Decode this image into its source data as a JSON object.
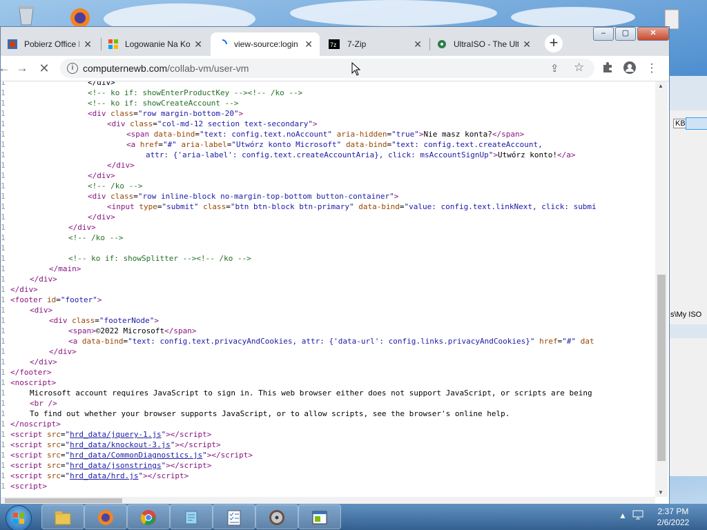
{
  "tabs": [
    {
      "title": "Pobierz Office Pro",
      "favicon": "office-icon"
    },
    {
      "title": "Logowanie Na Ko",
      "favicon": "microsoft-icon"
    },
    {
      "title": "view-source:login",
      "favicon": "loading-icon"
    },
    {
      "title": "7-Zip",
      "favicon": "7zip-icon"
    },
    {
      "title": "UltraISO - The Ult",
      "favicon": "ultraiso-icon"
    }
  ],
  "address": {
    "domain": "computernewb.com",
    "path": "/collab-vm/user-vm"
  },
  "source_lines": [
    {
      "indent": 16,
      "html": "&lt;/div&gt;"
    },
    {
      "indent": 16,
      "html": "&lt;!-- ko if: showEnterProductKey --&gt;&lt;!-- /ko --&gt;",
      "comment": true
    },
    {
      "indent": 16,
      "html": "&lt;!-- ko if: showCreateAccount --&gt;",
      "comment": true
    },
    {
      "indent": 16,
      "html": "<span class=\"tag\">&lt;div</span> <span class=\"att\">class</span>=<span class=\"val\">\"row margin-bottom-20\"</span><span class=\"tag\">&gt;</span>"
    },
    {
      "indent": 20,
      "html": "<span class=\"tag\">&lt;div</span> <span class=\"att\">class</span>=<span class=\"val\">\"col-md-12 section text-secondary\"</span><span class=\"tag\">&gt;</span>"
    },
    {
      "indent": 24,
      "html": "<span class=\"tag\">&lt;span</span> <span class=\"att\">data-bind</span>=<span class=\"val\">\"text: config.text.noAccount\"</span> <span class=\"att\">aria-hidden</span>=<span class=\"val\">\"true\"</span><span class=\"tag\">&gt;</span>Nie masz konta?<span class=\"tag\">&lt;/span&gt;</span>"
    },
    {
      "indent": 24,
      "html": "<span class=\"tag\">&lt;a</span> <span class=\"att\">href</span>=<span class=\"val\">\"#\"</span> <span class=\"att\">aria-label</span>=<span class=\"val\">\"Utwórz konto Microsoft\"</span> <span class=\"att\">data-bind</span>=<span class=\"val\">\"text: config.text.createAccount,</span>"
    },
    {
      "indent": 28,
      "html": "<span class=\"val\">attr: {'aria-label': config.text.createAccountAria}, click: msAccountSignUp\"</span><span class=\"tag\">&gt;</span>Utwórz konto!<span class=\"tag\">&lt;/a&gt;</span>"
    },
    {
      "indent": 20,
      "html": "<span class=\"tag\">&lt;/div&gt;</span>"
    },
    {
      "indent": 16,
      "html": "<span class=\"tag\">&lt;/div&gt;</span>"
    },
    {
      "indent": 16,
      "html": "&lt;!-- /ko --&gt;",
      "comment": true
    },
    {
      "indent": 16,
      "html": "<span class=\"tag\">&lt;div</span> <span class=\"att\">class</span>=<span class=\"val\">\"row inline-block no-margin-top-bottom button-container\"</span><span class=\"tag\">&gt;</span>"
    },
    {
      "indent": 20,
      "html": "<span class=\"tag\">&lt;input</span> <span class=\"att\">type</span>=<span class=\"val\">\"submit\"</span> <span class=\"att\">class</span>=<span class=\"val\">\"btn btn-block btn-primary\"</span> <span class=\"att\">data-bind</span>=<span class=\"val\">\"value: config.text.linkNext, click: submi</span>"
    },
    {
      "indent": 16,
      "html": "<span class=\"tag\">&lt;/div&gt;</span>"
    },
    {
      "indent": 12,
      "html": "<span class=\"tag\">&lt;/div&gt;</span>"
    },
    {
      "indent": 12,
      "html": "&lt;!-- /ko --&gt;",
      "comment": true
    },
    {
      "indent": 0,
      "html": ""
    },
    {
      "indent": 12,
      "html": "&lt;!-- ko if: showSplitter --&gt;&lt;!-- /ko --&gt;",
      "comment": true
    },
    {
      "indent": 8,
      "html": "<span class=\"tag\">&lt;/main&gt;</span>"
    },
    {
      "indent": 4,
      "html": "<span class=\"tag\">&lt;/div&gt;</span>"
    },
    {
      "indent": 0,
      "html": "<span class=\"tag\">&lt;/div&gt;</span>"
    },
    {
      "indent": 0,
      "html": "<span class=\"tag\">&lt;footer</span> <span class=\"att\">id</span>=<span class=\"val\">\"footer\"</span><span class=\"tag\">&gt;</span>"
    },
    {
      "indent": 4,
      "html": "<span class=\"tag\">&lt;div&gt;</span>"
    },
    {
      "indent": 8,
      "html": "<span class=\"tag\">&lt;div</span> <span class=\"att\">class</span>=<span class=\"val\">\"footerNode\"</span><span class=\"tag\">&gt;</span>"
    },
    {
      "indent": 12,
      "html": "<span class=\"tag\">&lt;span&gt;</span>©2022 Microsoft<span class=\"tag\">&lt;/span&gt;</span>"
    },
    {
      "indent": 12,
      "html": "<span class=\"tag\">&lt;a</span> <span class=\"att\">data-bind</span>=<span class=\"val\">\"text: config.text.privacyAndCookies, attr: {'data-url': config.links.privacyAndCookies}\"</span> <span class=\"att\">href</span>=<span class=\"val\">\"#\"</span> <span class=\"att\">dat</span>"
    },
    {
      "indent": 8,
      "html": "<span class=\"tag\">&lt;/div&gt;</span>"
    },
    {
      "indent": 4,
      "html": "<span class=\"tag\">&lt;/div&gt;</span>"
    },
    {
      "indent": 0,
      "html": "<span class=\"tag\">&lt;/footer&gt;</span>"
    },
    {
      "indent": 0,
      "html": "<span class=\"tag\">&lt;noscript&gt;</span>"
    },
    {
      "indent": 4,
      "html": "Microsoft account requires JavaScript to sign in. This web browser either does not support JavaScript, or scripts are being"
    },
    {
      "indent": 4,
      "html": "<span class=\"tag\">&lt;br /&gt;</span>"
    },
    {
      "indent": 4,
      "html": "To find out whether your browser supports JavaScript, or to allow scripts, see the browser's online help."
    },
    {
      "indent": 0,
      "html": "<span class=\"tag\">&lt;/noscript&gt;</span>"
    },
    {
      "indent": 0,
      "html": "<span class=\"tag\">&lt;script</span> <span class=\"att\">src</span>=<span class=\"val\">\"</span><span class=\"lnk\">hrd_data/jquery-1.js</span><span class=\"val\">\"</span><span class=\"tag\">&gt;&lt;/script&gt;</span>"
    },
    {
      "indent": 0,
      "html": "<span class=\"tag\">&lt;script</span> <span class=\"att\">src</span>=<span class=\"val\">\"</span><span class=\"lnk\">hrd_data/knockout-3.js</span><span class=\"val\">\"</span><span class=\"tag\">&gt;&lt;/script&gt;</span>"
    },
    {
      "indent": 0,
      "html": "<span class=\"tag\">&lt;script</span> <span class=\"att\">src</span>=<span class=\"val\">\"</span><span class=\"lnk\">hrd_data/CommonDiagnostics.js</span><span class=\"val\">\"</span><span class=\"tag\">&gt;&lt;/script&gt;</span>"
    },
    {
      "indent": 0,
      "html": "<span class=\"tag\">&lt;script</span> <span class=\"att\">src</span>=<span class=\"val\">\"</span><span class=\"lnk\">hrd_data/jsonstrings</span><span class=\"val\">\"</span><span class=\"tag\">&gt;&lt;/script&gt;</span>"
    },
    {
      "indent": 0,
      "html": "<span class=\"tag\">&lt;script</span> <span class=\"att\">src</span>=<span class=\"val\">\"</span><span class=\"lnk\">hrd_data/hrd.js</span><span class=\"val\">\"</span><span class=\"tag\">&gt;&lt;/script&gt;</span>"
    },
    {
      "indent": 0,
      "html": "<span class=\"tag\">&lt;script&gt;</span>"
    }
  ],
  "taskbar": {
    "items": [
      "explorer-icon",
      "firefox-icon",
      "chrome-icon",
      "notepad-icon",
      "checklist-icon",
      "disc-icon",
      "window-icon"
    ],
    "time": "2:37 PM",
    "date": "2/6/2022"
  },
  "background_labels": {
    "kb": "KB",
    "myiso": "s\\My ISO"
  }
}
